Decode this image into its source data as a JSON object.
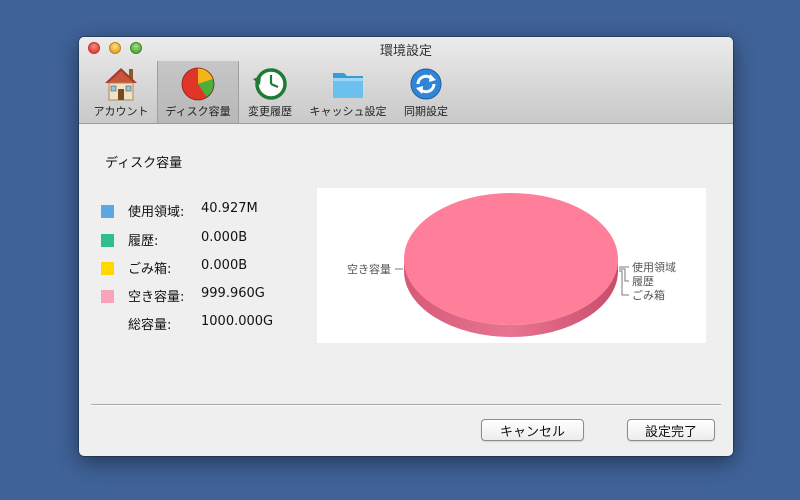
{
  "window": {
    "title": "環境設定"
  },
  "toolbar": {
    "items": [
      {
        "label": "アカウント",
        "icon": "house-icon"
      },
      {
        "label": "ディスク容量",
        "icon": "pie-chart-icon",
        "selected": true
      },
      {
        "label": "変更履歴",
        "icon": "clock-history-icon"
      },
      {
        "label": "キャッシュ設定",
        "icon": "folder-icon"
      },
      {
        "label": "同期設定",
        "icon": "sync-icon"
      }
    ]
  },
  "section": {
    "title": "ディスク容量"
  },
  "legend": {
    "items": [
      {
        "label": "使用領域:",
        "value": "40.927M",
        "color": "#5aa9e6"
      },
      {
        "label": "履歴:",
        "value": "0.000B",
        "color": "#2ebf8a"
      },
      {
        "label": "ごみ箱:",
        "value": "0.000B",
        "color": "#ffd800"
      },
      {
        "label": "空き容量:",
        "value": "999.960G",
        "color": "#f7a4b8"
      }
    ],
    "total": {
      "label": "総容量:",
      "value": "1000.000G"
    }
  },
  "chart_data": {
    "type": "pie",
    "labels": [
      "使用領域",
      "履歴",
      "ごみ箱",
      "空き容量"
    ],
    "values": [
      0.040927,
      0,
      0,
      999.96
    ],
    "colors": [
      "#5aa9e6",
      "#2ebf8a",
      "#ffd800",
      "#ff7f9a"
    ],
    "style": "3d"
  },
  "buttons": {
    "cancel": "キャンセル",
    "done": "設定完了"
  }
}
